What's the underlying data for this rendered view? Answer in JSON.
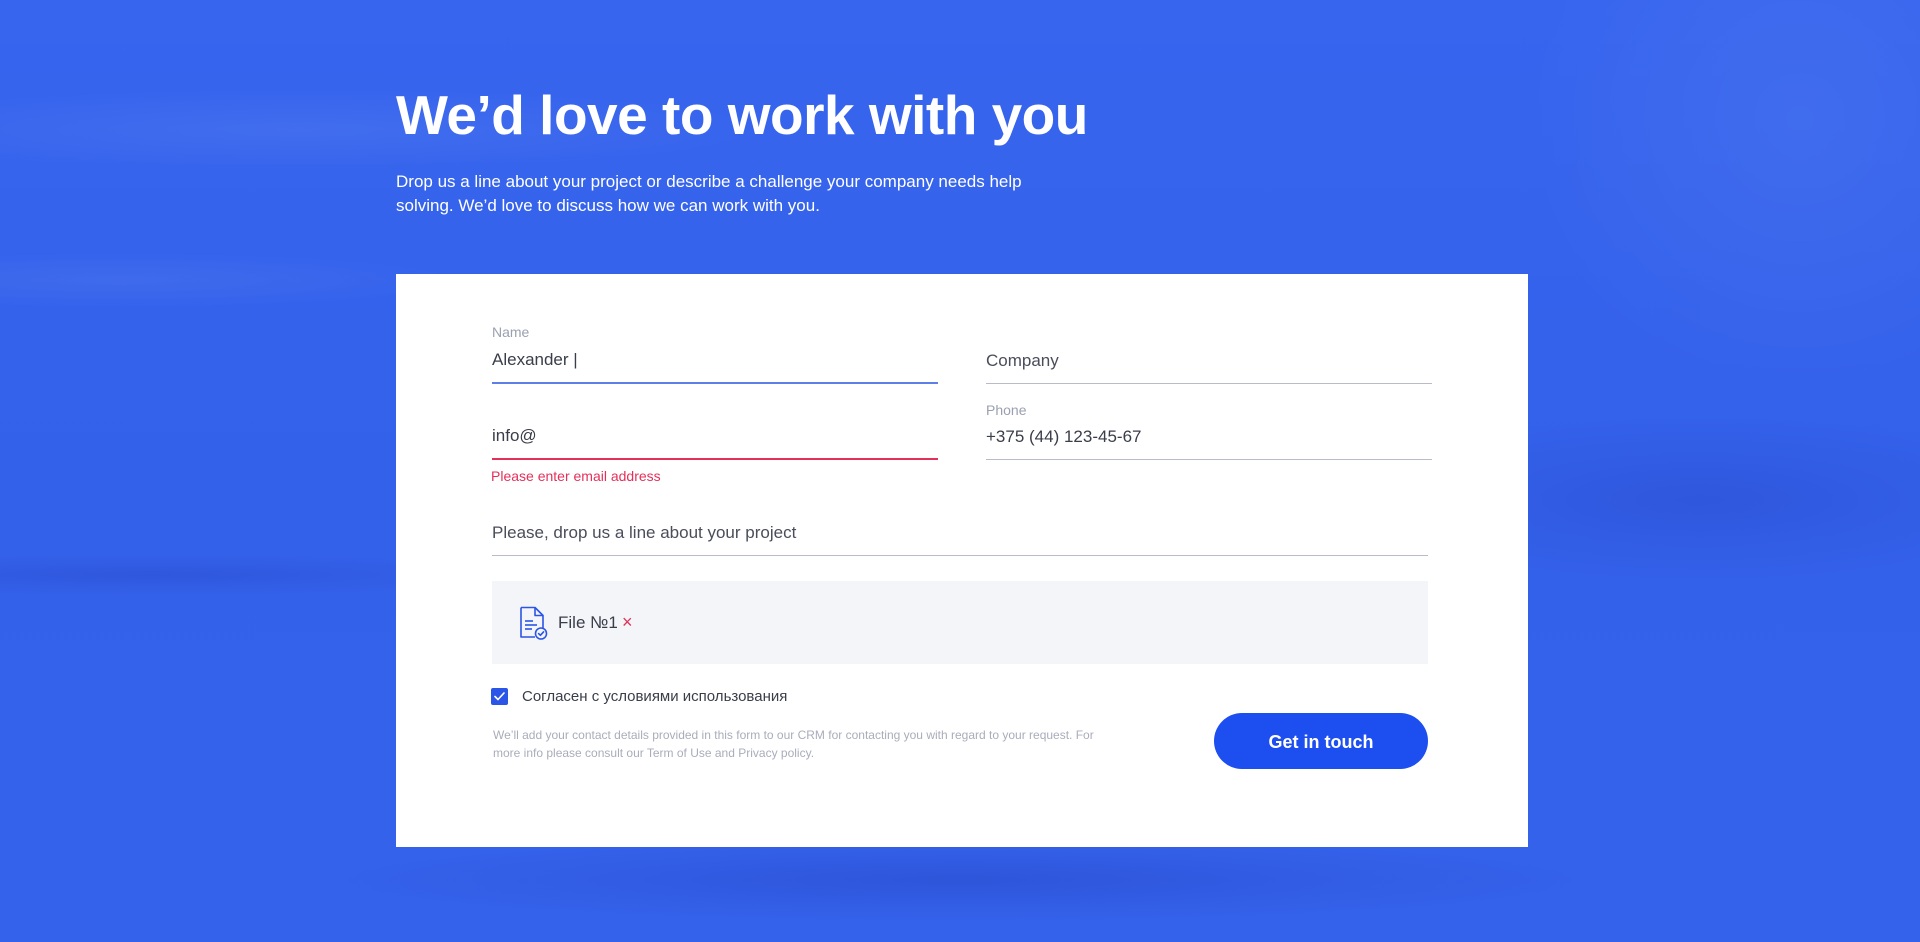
{
  "hero": {
    "title": "We’d love to work with you",
    "description": "Drop us a line about your project or describe a challenge your company needs help solving. We’d love to discuss how we can work with you."
  },
  "form": {
    "name": {
      "label": "Name",
      "value": "Alexander |"
    },
    "company": {
      "placeholder": "Company"
    },
    "email": {
      "value": "info@",
      "error": "Please enter email address"
    },
    "phone": {
      "label": "Phone",
      "value": "+375 (44) 123-45-67"
    },
    "message": {
      "placeholder": "Please, drop us a line about your project"
    },
    "attachment": {
      "icon": "file-check-icon",
      "name": "File №1",
      "remove_symbol": "×"
    },
    "consent": {
      "checked": true,
      "label": "Согласен с условиями использования"
    },
    "disclaimer": "We’ll add your contact details provided in this form to our CRM for contacting you with regard to your request. For more info please consult our Term of Use and Privacy policy.",
    "submit_label": "Get in touch"
  },
  "colors": {
    "background": "#3563ec",
    "accent": "#1c4ef0",
    "error": "#e3305a",
    "active_field": "#5f7fe8"
  }
}
